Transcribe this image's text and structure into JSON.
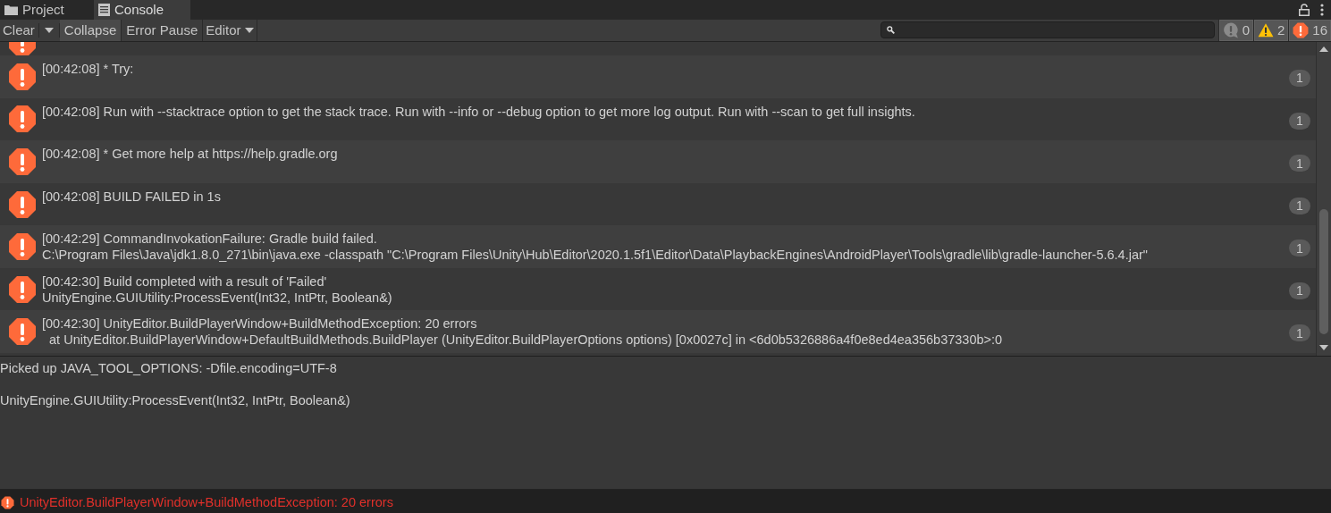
{
  "tabs": [
    {
      "label": "Project",
      "kind": "folder",
      "selected": false
    },
    {
      "label": "Console",
      "kind": "console",
      "selected": true
    }
  ],
  "toolbar": {
    "buttons": [
      {
        "label": "Clear",
        "kind": "button",
        "on": false
      },
      {
        "kind": "dropdown-arrow",
        "on": false
      },
      {
        "label": "Collapse",
        "kind": "toggle",
        "on": true
      },
      {
        "label": "Error Pause",
        "kind": "toggle",
        "on": false
      },
      {
        "label": "Editor",
        "kind": "dropdown",
        "on": false
      }
    ],
    "counters": [
      {
        "kind": "info",
        "count": "0"
      },
      {
        "kind": "warning",
        "count": "2"
      },
      {
        "kind": "error",
        "count": "16"
      }
    ]
  },
  "entries": [
    {
      "kind": "partial"
    },
    {
      "kind": "error",
      "lines": [
        "[00:42:08] * Try:"
      ],
      "count": "1"
    },
    {
      "kind": "error",
      "lines": [
        "[00:42:08] Run with --stacktrace option to get the stack trace. Run with --info or --debug option to get more log output. Run with --scan to get full insights."
      ],
      "count": "1"
    },
    {
      "kind": "error",
      "lines": [
        "[00:42:08] * Get more help at https://help.gradle.org"
      ],
      "count": "1"
    },
    {
      "kind": "error",
      "lines": [
        "[00:42:08] BUILD FAILED in 1s"
      ],
      "count": "1"
    },
    {
      "kind": "error",
      "lines": [
        "[00:42:29] CommandInvokationFailure: Gradle build failed.",
        "C:\\Program Files\\Java\\jdk1.8.0_271\\bin\\java.exe -classpath \"C:\\Program Files\\Unity\\Hub\\Editor\\2020.1.5f1\\Editor\\Data\\PlaybackEngines\\AndroidPlayer\\Tools\\gradle\\lib\\gradle-launcher-5.6.4.jar\""
      ],
      "count": "1"
    },
    {
      "kind": "error",
      "lines": [
        "[00:42:30] Build completed with a result of 'Failed'",
        "UnityEngine.GUIUtility:ProcessEvent(Int32, IntPtr, Boolean&)"
      ],
      "count": "1"
    },
    {
      "kind": "error",
      "lines": [
        "[00:42:30] UnityEditor.BuildPlayerWindow+BuildMethodException: 20 errors",
        "  at UnityEditor.BuildPlayerWindow+DefaultBuildMethods.BuildPlayer (UnityEditor.BuildPlayerOptions options) [0x0027c] in <6d0b5326886a4f0e8ed4ea356b37330b>:0"
      ],
      "count": "1"
    }
  ],
  "detail": [
    "Picked up JAVA_TOOL_OPTIONS: -Dfile.encoding=UTF-8",
    "UnityEngine.GUIUtility:ProcessEvent(Int32, IntPtr, Boolean&)"
  ],
  "status_bar": {
    "kind": "error",
    "text": "UnityEditor.BuildPlayerWindow+BuildMethodException: 20 errors"
  }
}
